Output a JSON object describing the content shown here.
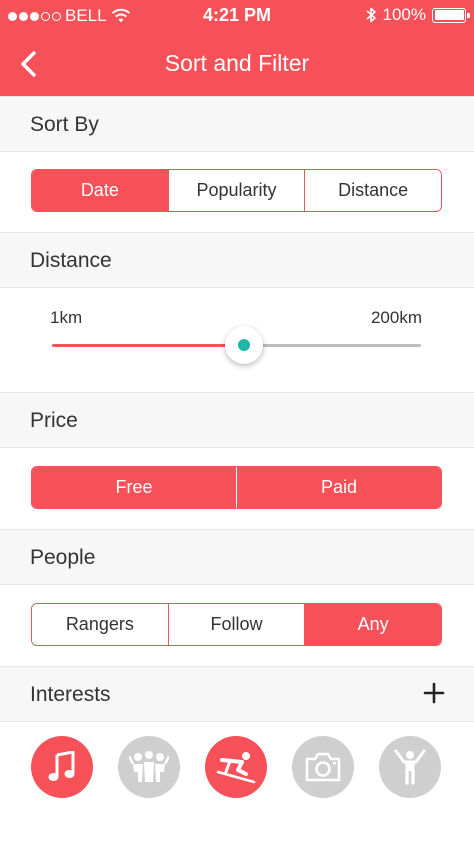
{
  "status": {
    "carrier": "BELL",
    "time": "4:21 PM",
    "battery": "100%"
  },
  "nav": {
    "title": "Sort and Filter"
  },
  "sort": {
    "label": "Sort By",
    "options": [
      "Date",
      "Popularity",
      "Distance"
    ],
    "selected": "Date"
  },
  "distance": {
    "label": "Distance",
    "min_label": "1km",
    "max_label": "200km",
    "value_fraction": 0.52
  },
  "price": {
    "label": "Price",
    "options": [
      "Free",
      "Paid"
    ]
  },
  "people": {
    "label": "People",
    "options": [
      "Rangers",
      "Follow",
      "Any"
    ],
    "selected": "Any"
  },
  "interests": {
    "label": "Interests",
    "items": [
      {
        "icon": "music-note-icon",
        "selected": true
      },
      {
        "icon": "group-people-icon",
        "selected": false
      },
      {
        "icon": "skiing-icon",
        "selected": true
      },
      {
        "icon": "camera-icon",
        "selected": false
      },
      {
        "icon": "person-celebrating-icon",
        "selected": false
      }
    ]
  },
  "colors": {
    "accent": "#f65158",
    "thumb_dot": "#1fb5a9",
    "inactive": "#cfcfcf"
  }
}
